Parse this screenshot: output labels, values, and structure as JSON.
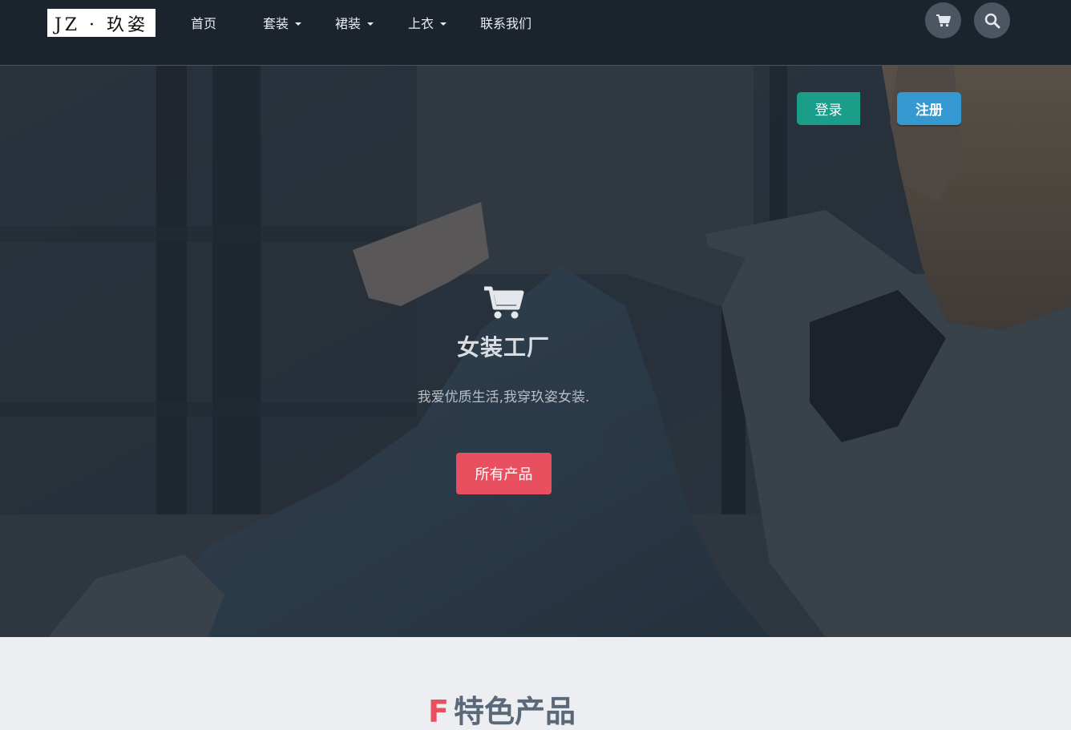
{
  "navbar": {
    "logo_text": "JZ · 玖姿",
    "items": [
      {
        "label": "首页",
        "has_dropdown": false
      },
      {
        "label": "套装",
        "has_dropdown": true
      },
      {
        "label": "裙装",
        "has_dropdown": true
      },
      {
        "label": "上衣",
        "has_dropdown": true
      },
      {
        "label": "联系我们",
        "has_dropdown": false
      }
    ],
    "icons": [
      "cart-icon",
      "search-icon"
    ]
  },
  "hero": {
    "login_label": "登录",
    "register_label": "注册",
    "icon": "cart-icon",
    "title": "女装工厂",
    "subtitle": "我爱优质生活,我穿玖姿女装.",
    "cta_label": "所有产品"
  },
  "featured": {
    "title_letter": "F",
    "title_text": "特色产品"
  },
  "colors": {
    "navbar_bg": "#1b232c",
    "login_button": "#1a9e8a",
    "register_button": "#3598d0",
    "cta_button": "#e9505f",
    "section_bg": "#eceef1",
    "section_title": "#5b6878"
  }
}
